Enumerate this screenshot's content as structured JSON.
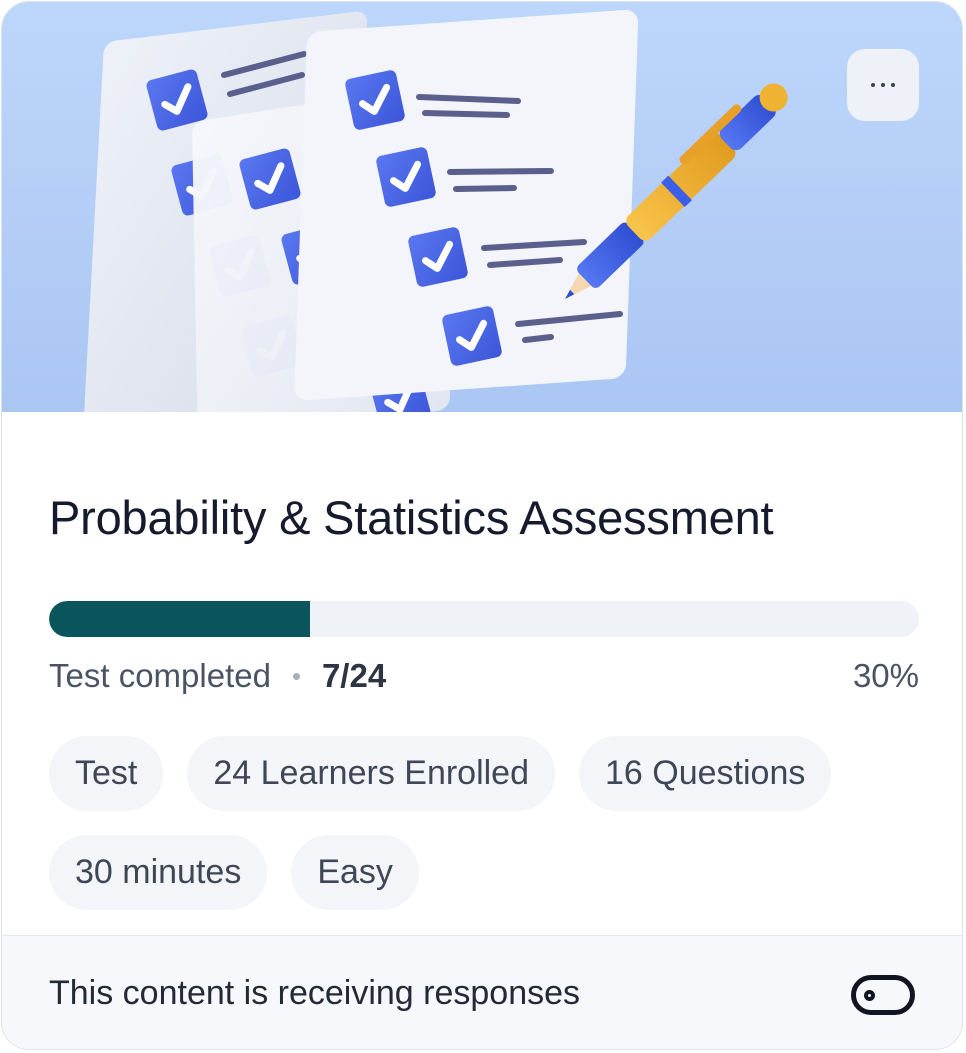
{
  "card": {
    "hero": {
      "illustration": "checklist-with-pen-illustration",
      "menu_icon": "more-horizontal-icon"
    },
    "title": "Probability & Statistics Assessment",
    "progress": {
      "fraction": 0.3,
      "status_label": "Test completed",
      "count_label": "7/24",
      "percent_label": "30%"
    },
    "tags": [
      "Test",
      "24 Learners Enrolled",
      "16 Questions",
      "30 minutes",
      "Easy"
    ],
    "footer": {
      "text": "This content is receiving responses",
      "toggle_icon": "toggle-off-icon"
    }
  },
  "colors": {
    "progress_fill": "#0a555c",
    "progress_track": "#eff2f7",
    "hero_background": "#b8d1f8",
    "checkbox_blue": "#4a67e6",
    "pen_yellow": "#f0b233"
  }
}
